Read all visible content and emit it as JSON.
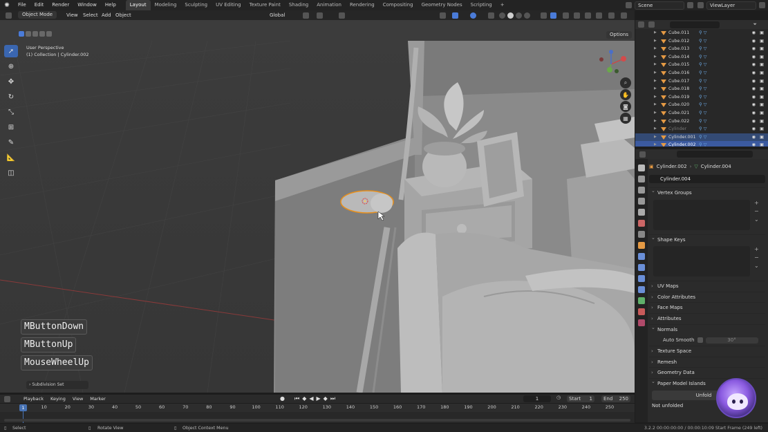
{
  "topbar": {
    "menu": [
      "File",
      "Edit",
      "Render",
      "Window",
      "Help"
    ],
    "workspaces": [
      "Layout",
      "Modeling",
      "Sculpting",
      "UV Editing",
      "Texture Paint",
      "Shading",
      "Animation",
      "Rendering",
      "Compositing",
      "Geometry Nodes",
      "Scripting"
    ],
    "active_workspace": "Layout",
    "add_tab": "+",
    "scene": "Scene",
    "view_layer": "ViewLayer"
  },
  "viewport_header": {
    "mode": "Object Mode",
    "menus": [
      "View",
      "Select",
      "Add",
      "Object"
    ],
    "orientation": "Global"
  },
  "viewport": {
    "view_name": "User Perspective",
    "collection_line": "(1) Collection | Cylinder.002",
    "options": "Options"
  },
  "keycast": [
    "MButtonDown",
    "MButtonUp",
    "MouseWheelUp"
  ],
  "last_operator": "Subdivision Set",
  "outliner": {
    "rows": [
      {
        "name": "Cube.011",
        "state": "normal"
      },
      {
        "name": "Cube.012",
        "state": "normal"
      },
      {
        "name": "Cube.013",
        "state": "normal"
      },
      {
        "name": "Cube.014",
        "state": "normal"
      },
      {
        "name": "Cube.015",
        "state": "normal"
      },
      {
        "name": "Cube.016",
        "state": "normal"
      },
      {
        "name": "Cube.017",
        "state": "normal"
      },
      {
        "name": "Cube.018",
        "state": "normal"
      },
      {
        "name": "Cube.019",
        "state": "normal"
      },
      {
        "name": "Cube.020",
        "state": "normal"
      },
      {
        "name": "Cube.021",
        "state": "normal"
      },
      {
        "name": "Cube.022",
        "state": "normal"
      },
      {
        "name": "Cylinder",
        "state": "dim"
      },
      {
        "name": "Cylinder.001",
        "state": "selected"
      },
      {
        "name": "Cylinder.002",
        "state": "active"
      }
    ]
  },
  "properties": {
    "object_name": "Cylinder.002",
    "mesh_crumb": "Cylinder.004",
    "mesh_datablock": "Cylinder.004",
    "panels": [
      {
        "label": "Vertex Groups",
        "open": true
      },
      {
        "label": "Shape Keys",
        "open": true
      },
      {
        "label": "UV Maps",
        "open": false
      },
      {
        "label": "Color Attributes",
        "open": false
      },
      {
        "label": "Face Maps",
        "open": false
      },
      {
        "label": "Attributes",
        "open": false
      },
      {
        "label": "Normals",
        "open": true
      },
      {
        "label": "Texture Space",
        "open": false
      },
      {
        "label": "Remesh",
        "open": false
      },
      {
        "label": "Geometry Data",
        "open": false
      },
      {
        "label": "Paper Model Islands",
        "open": true
      }
    ],
    "auto_smooth_label": "Auto Smooth",
    "auto_smooth_angle": "30°",
    "unfold_button": "Unfold",
    "not_unfolded": "Not unfolded"
  },
  "timeline": {
    "menus": [
      "Playback",
      "Keying",
      "View",
      "Marker"
    ],
    "current_frame": "1",
    "start_label": "Start",
    "start_value": "1",
    "end_label": "End",
    "end_value": "250",
    "ticks": [
      "10",
      "20",
      "30",
      "40",
      "50",
      "60",
      "70",
      "80",
      "90",
      "100",
      "110",
      "120",
      "130",
      "140",
      "150",
      "160",
      "170",
      "180",
      "190",
      "200",
      "210",
      "220",
      "230",
      "240",
      "250"
    ],
    "playhead": "1"
  },
  "statusbar": {
    "left": "Select",
    "middle": "Rotate View",
    "right": "Object Context Menu",
    "version": "3.2.2  00:00:00:00 / 00:00:10:09  Start Frame (249 left)"
  },
  "colors": {
    "accent": "#4772b3",
    "selection_outline": "#e8901c",
    "object_icon": "#e59a44"
  }
}
